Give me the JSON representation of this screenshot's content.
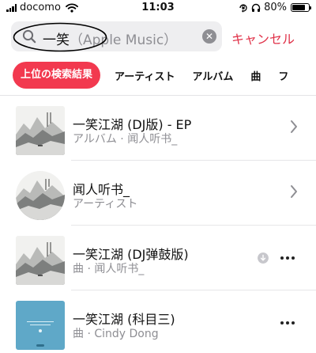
{
  "status_bar": {
    "carrier": "docomo",
    "time": "11:03",
    "battery": "80%",
    "battery_level": 0.8,
    "icons": [
      "signal-icon",
      "wifi-icon",
      "orientation-lock-icon",
      "headphones-icon",
      "battery-icon"
    ]
  },
  "search": {
    "query": "一笑",
    "placeholder": "（Apple Music）",
    "cancel_label": "キャンセル",
    "icons": [
      "search-icon",
      "clear-icon"
    ]
  },
  "tabs": [
    {
      "label": "上位の検索結果",
      "active": true
    },
    {
      "label": "アーティスト",
      "active": false
    },
    {
      "label": "アルバム",
      "active": false
    },
    {
      "label": "曲",
      "active": false
    },
    {
      "label": "フ",
      "active": false
    }
  ],
  "results": [
    {
      "title": "一笑江湖 (DJ版) - EP",
      "subtitle": "アルバム · 闻人听书_",
      "art": "ink-landscape",
      "shape": "square",
      "accessory": "chevron-right-icon"
    },
    {
      "title": "闻人听书_",
      "subtitle": "アーティスト",
      "art": "ink-landscape",
      "shape": "round",
      "accessory": "chevron-right-icon"
    },
    {
      "title": "一笑江湖 (DJ弹鼓版)",
      "subtitle": "曲 · 闻人听书_",
      "art": "ink-landscape",
      "shape": "square",
      "accessory": "more-icon",
      "download_icon": "download-icon"
    },
    {
      "title": "一笑江湖 (科目三)",
      "subtitle": "曲 · Cindy Dong",
      "art": "blue-cover",
      "shape": "square",
      "accessory": "more-icon"
    }
  ],
  "colors": {
    "accent": "#f2394f",
    "cancel": "#e0334a",
    "secondary_text": "#8e8e93",
    "search_bg": "#eeeef0",
    "blue_cover": "#5fa8c8"
  }
}
